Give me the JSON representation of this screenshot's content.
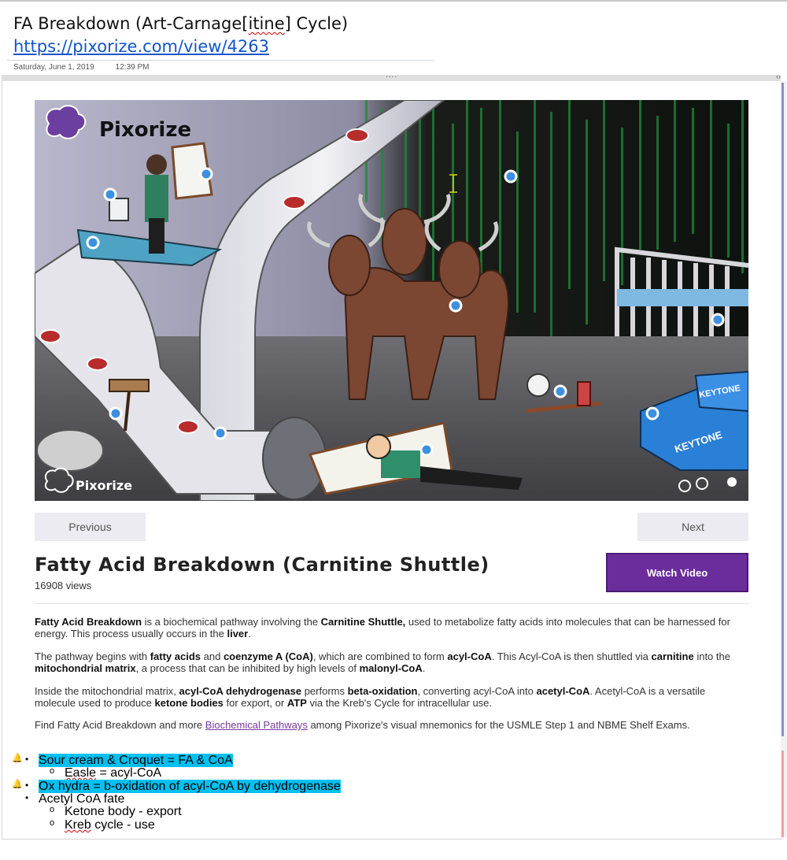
{
  "page": {
    "title_part1": "FA Breakdown (Art-Carnage[",
    "title_part2": "itine",
    "title_part3": "] Cycle)",
    "url": "https://pixorize.com/view/4263",
    "date": "Saturday, June 1, 2019",
    "time": "12:39 PM"
  },
  "frame": {
    "dots": "....",
    "arrows": "‹›"
  },
  "hero": {
    "logo_top": "Pixorize",
    "logo_bottom": "Pixorize",
    "keytone_1": "KEYTONE",
    "keytone_2": "KEYTONE"
  },
  "nav": {
    "previous": "Previous",
    "next": "Next"
  },
  "content": {
    "heading": "Fatty Acid Breakdown (Carnitine Shuttle)",
    "views": "16908 views",
    "watch_video": "Watch Video",
    "p1": [
      {
        "t": "Fatty Acid Breakdown",
        "b": true
      },
      {
        "t": " is a biochemical pathway involving the "
      },
      {
        "t": "Carnitine Shuttle,",
        "b": true
      },
      {
        "t": " used to metabolize fatty acids into molecules that can be harnessed for energy. This process usually occurs in the "
      },
      {
        "t": "liver",
        "b": true
      },
      {
        "t": "."
      }
    ],
    "p2": [
      {
        "t": "The pathway begins with "
      },
      {
        "t": "fatty acids",
        "b": true
      },
      {
        "t": " and "
      },
      {
        "t": "coenzyme A (CoA)",
        "b": true
      },
      {
        "t": ", which are combined to form "
      },
      {
        "t": "acyl-CoA",
        "b": true
      },
      {
        "t": ". This Acyl-CoA is then shuttled via "
      },
      {
        "t": "carnitine",
        "b": true
      },
      {
        "t": " into the "
      },
      {
        "t": "mitochondrial matrix",
        "b": true
      },
      {
        "t": ", a process that can be inhibited by high levels of "
      },
      {
        "t": "malonyl-CoA",
        "b": true
      },
      {
        "t": "."
      }
    ],
    "p3": [
      {
        "t": "Inside the mitochondrial matrix, "
      },
      {
        "t": "acyl-CoA dehydrogenase",
        "b": true
      },
      {
        "t": " performs "
      },
      {
        "t": "beta-oxidation",
        "b": true
      },
      {
        "t": ", converting acyl-CoA into "
      },
      {
        "t": "acetyl-CoA",
        "b": true
      },
      {
        "t": ". Acetyl-CoA is a versatile molecule used to produce "
      },
      {
        "t": "ketone bodies",
        "b": true
      },
      {
        "t": " for export, or "
      },
      {
        "t": "ATP",
        "b": true
      },
      {
        "t": " via the Kreb's Cycle for intracellular use."
      }
    ],
    "p4_before": "Find Fatty Acid Breakdown and more ",
    "p4_link": "Biochemical Pathways",
    "p4_after": " among Pixorize's visual mnemonics for the USMLE Step 1 and NBME Shelf Exams."
  },
  "notes": {
    "n1": "Sour cream & Croquet = FA & CoA",
    "n1a_word": "Easle",
    "n1a_rest": " = acyl-CoA",
    "n2": "Ox hydra = b-oxidation of acyl-CoA by dehydrogenase",
    "n3": "Acetyl CoA fate",
    "n3a": "Ketone body - export",
    "n3b_word": "Kreb",
    "n3b_rest": " cycle - use",
    "bullet": "•",
    "sub_bullet": "o"
  },
  "colors": {
    "accent_purple": "#6b2d9c",
    "link_blue": "#1155cc",
    "highlight": "#00c0f0",
    "hotspot": "#3d8fe0"
  }
}
